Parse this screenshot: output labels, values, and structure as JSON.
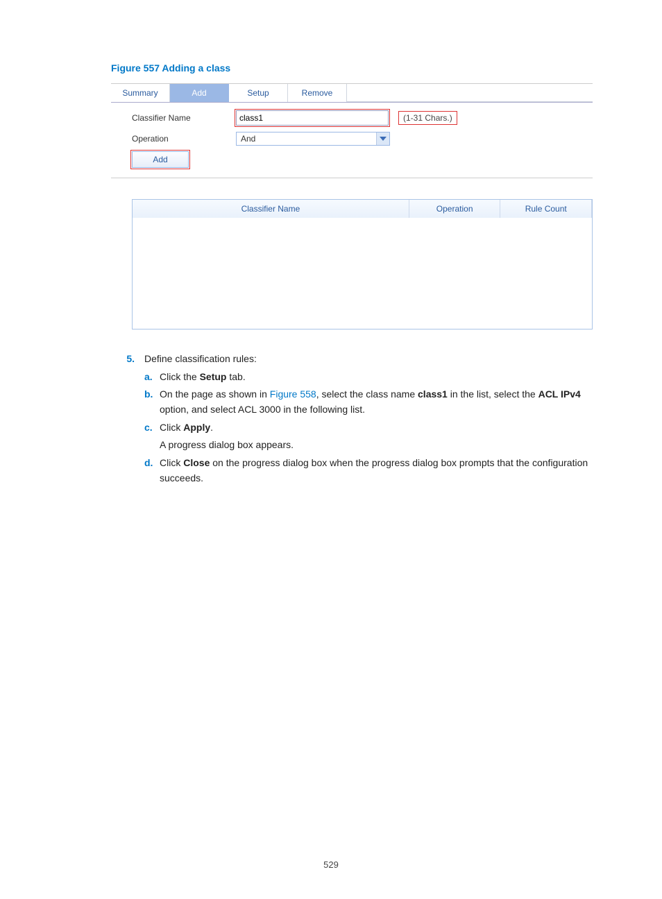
{
  "figure_title": "Figure 557 Adding a class",
  "tabs": {
    "summary": "Summary",
    "add": "Add",
    "setup": "Setup",
    "remove": "Remove"
  },
  "form": {
    "classifier_name_label": "Classifier Name",
    "classifier_name_value": "class1",
    "classifier_name_hint": "(1-31 Chars.)",
    "operation_label": "Operation",
    "operation_value": "And",
    "add_button": "Add"
  },
  "grid": {
    "col_name": "Classifier Name",
    "col_op": "Operation",
    "col_cnt": "Rule Count"
  },
  "instr": {
    "item5_num": "5.",
    "item5_text": "Define classification rules:",
    "a_letter": "a.",
    "a_pre": "Click the ",
    "a_bold": "Setup",
    "a_post": " tab.",
    "b_letter": "b.",
    "b_pre": "On the page as shown in ",
    "b_link": "Figure 558",
    "b_mid1": ", select the class name ",
    "b_bold1": "class1",
    "b_mid2": " in the list, select the ",
    "b_bold2": "ACL IPv4",
    "b_post": " option, and select ACL 3000 in the following list.",
    "c_letter": "c.",
    "c_pre": "Click ",
    "c_bold": "Apply",
    "c_post": ".",
    "c_extra": "A progress dialog box appears.",
    "d_letter": "d.",
    "d_pre": "Click ",
    "d_bold": "Close",
    "d_post": " on the progress dialog box when the progress dialog box prompts that the configuration succeeds."
  },
  "page_number": "529"
}
